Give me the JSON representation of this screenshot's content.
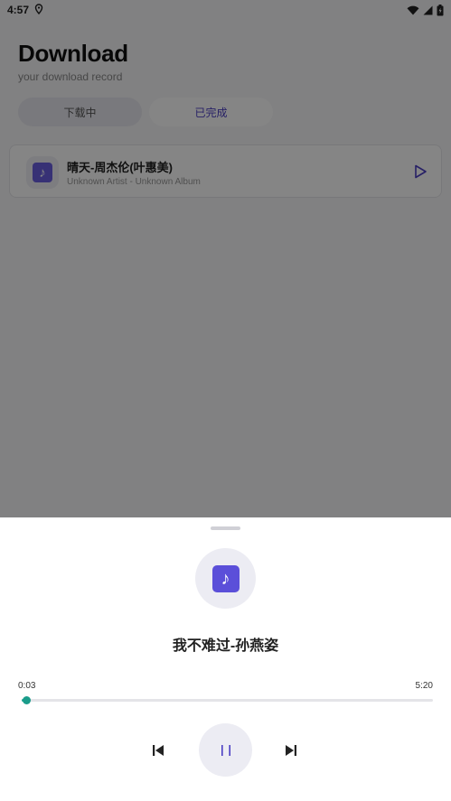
{
  "status_bar": {
    "time": "4:57"
  },
  "page": {
    "title": "Download",
    "subtitle": "your download record"
  },
  "tabs": [
    {
      "label": "下载中",
      "active": false
    },
    {
      "label": "已完成",
      "active": true
    }
  ],
  "downloads": [
    {
      "title": "晴天-周杰伦(叶惠美)",
      "subtitle": "Unknown Artist - Unknown Album",
      "icon": "music-note-icon",
      "action_icon": "play-icon"
    }
  ],
  "player": {
    "title": "我不难过-孙燕姿",
    "current_time": "0:03",
    "total_time": "5:20",
    "progress": 0.01,
    "state": "playing",
    "controls": [
      "previous-icon",
      "pause-icon",
      "next-icon"
    ]
  },
  "colors": {
    "accent": "#4b3fc4",
    "note_bg": "#6a5fe0",
    "progress": "#1aa893",
    "overlay": "rgba(0,0,0,0.48)"
  }
}
